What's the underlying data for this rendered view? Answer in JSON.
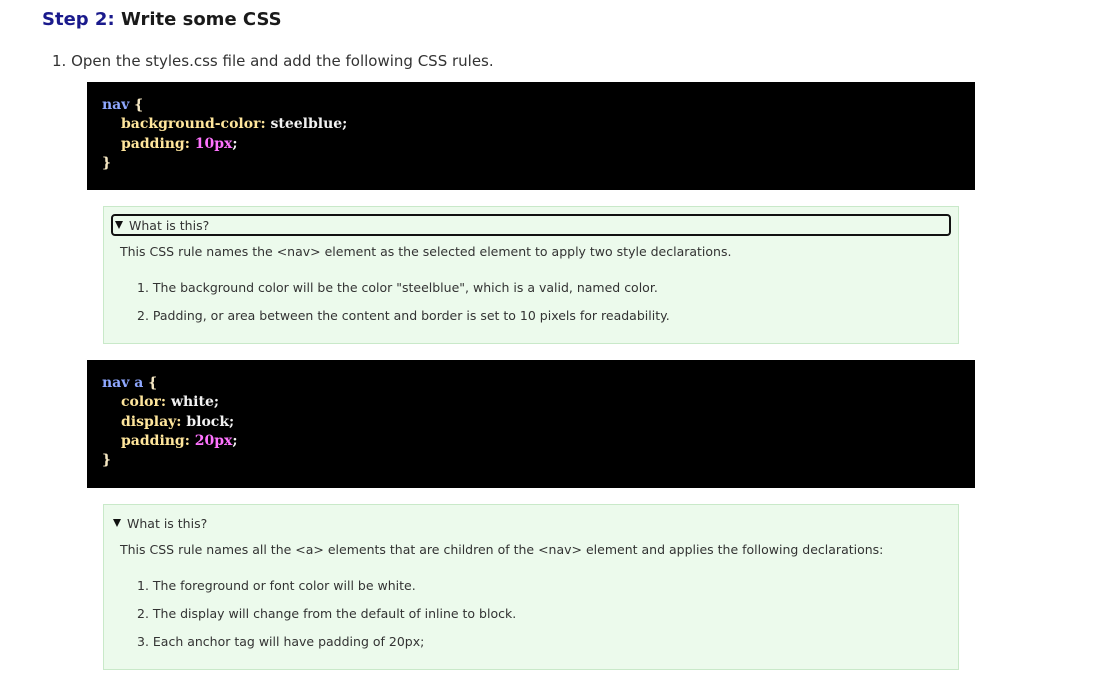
{
  "heading": {
    "step_label": "Step 2:",
    "title": "Write some CSS"
  },
  "instruction": {
    "number": "1.",
    "text": "Open the styles.css file and add the following CSS rules."
  },
  "code_blocks": [
    {
      "selector": "nav",
      "open_brace": "{",
      "close_brace": "}",
      "declarations": [
        {
          "property": "background-color:",
          "value": "steelblue",
          "is_number": false
        },
        {
          "property": "padding:",
          "value": "10px",
          "is_number": true
        }
      ]
    },
    {
      "selector": "nav a",
      "open_brace": "{",
      "close_brace": "}",
      "declarations": [
        {
          "property": "color:",
          "value": "white",
          "is_number": false
        },
        {
          "property": "display:",
          "value": "block",
          "is_number": false
        },
        {
          "property": "padding:",
          "value": "20px",
          "is_number": true
        }
      ]
    }
  ],
  "explanations": [
    {
      "summary": "What is this?",
      "description": "This CSS rule names the <nav> element as the selected element to apply two style declarations.",
      "items": [
        "1. The background color will be the color \"steelblue\", which is a valid, named color.",
        "2. Padding, or area between the content and border is set to 10 pixels for readability."
      ]
    },
    {
      "summary": "What is this?",
      "description": "This CSS rule names all the <a> elements that are children of the <nav> element and applies the following declarations:",
      "items": [
        "1. The foreground or font color will be white.",
        "2. The display will change from the default of inline to block.",
        "3. Each anchor tag will have padding of 20px;"
      ]
    }
  ],
  "icons": {
    "disclosure": "disclosure-triangle-down-icon"
  },
  "colors": {
    "code_background": "#000000",
    "details_background": "#ecfaec",
    "selector": "#8fa8ff",
    "property": "#ffe69c",
    "number": "#ff73ff",
    "heading_step": "#1a1a8c"
  }
}
